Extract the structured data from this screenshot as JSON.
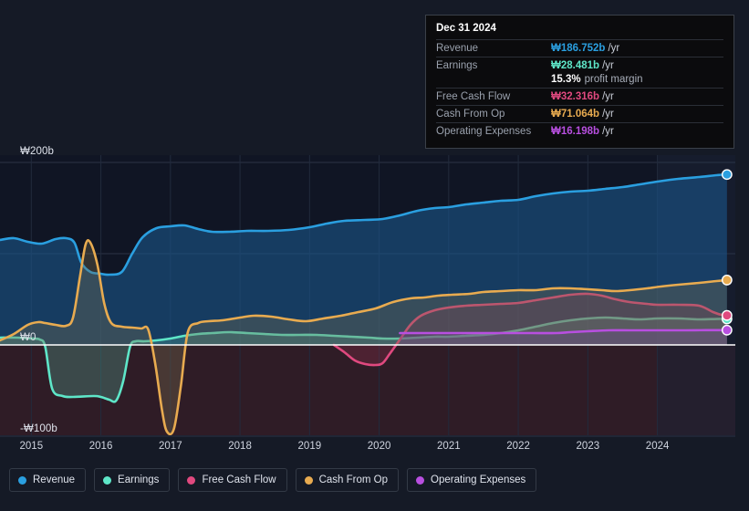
{
  "chart_data": {
    "type": "area",
    "title": "",
    "xlabel": "",
    "ylabel": "",
    "currency": "₩",
    "unit": "b",
    "ylim": [
      -140,
      230
    ],
    "yticks": [
      200,
      100,
      0,
      -100
    ],
    "ytick_labels": [
      "₩200b",
      "",
      "₩0",
      "-₩100b"
    ],
    "grid": true,
    "legend_position": "bottom",
    "xlim": [
      2014.55,
      2025.12
    ],
    "xticks": [
      2015,
      2016,
      2017,
      2018,
      2019,
      2020,
      2021,
      2022,
      2023,
      2024
    ],
    "xtick_labels": [
      "2015",
      "2016",
      "2017",
      "2018",
      "2019",
      "2020",
      "2021",
      "2022",
      "2023",
      "2024"
    ],
    "forecast_band_start": 2024.0,
    "series": [
      {
        "name": "Revenue",
        "color": "#2a9fe0",
        "fill": "rgba(26,84,136,0.62)",
        "end_value": 186.752,
        "points": [
          [
            2014.55,
            115
          ],
          [
            2014.75,
            117
          ],
          [
            2014.95,
            113
          ],
          [
            2015.15,
            111
          ],
          [
            2015.35,
            116
          ],
          [
            2015.5,
            117
          ],
          [
            2015.62,
            112
          ],
          [
            2015.72,
            90
          ],
          [
            2015.85,
            80
          ],
          [
            2016.0,
            78
          ],
          [
            2016.12,
            77
          ],
          [
            2016.3,
            80
          ],
          [
            2016.45,
            100
          ],
          [
            2016.6,
            118
          ],
          [
            2016.8,
            128
          ],
          [
            2017.0,
            130
          ],
          [
            2017.2,
            131
          ],
          [
            2017.4,
            127
          ],
          [
            2017.6,
            124
          ],
          [
            2017.85,
            124
          ],
          [
            2018.1,
            125
          ],
          [
            2018.4,
            125
          ],
          [
            2018.7,
            126
          ],
          [
            2019.0,
            129
          ],
          [
            2019.25,
            133
          ],
          [
            2019.5,
            136
          ],
          [
            2019.8,
            137
          ],
          [
            2020.05,
            138
          ],
          [
            2020.3,
            142
          ],
          [
            2020.55,
            147
          ],
          [
            2020.8,
            150
          ],
          [
            2021.0,
            151
          ],
          [
            2021.25,
            154
          ],
          [
            2021.5,
            156
          ],
          [
            2021.75,
            158
          ],
          [
            2022.0,
            159
          ],
          [
            2022.25,
            163
          ],
          [
            2022.5,
            166
          ],
          [
            2022.75,
            168
          ],
          [
            2023.0,
            169
          ],
          [
            2023.25,
            171
          ],
          [
            2023.5,
            173
          ],
          [
            2023.75,
            176
          ],
          [
            2024.0,
            179
          ],
          [
            2024.3,
            182
          ],
          [
            2024.6,
            184
          ],
          [
            2024.85,
            186
          ],
          [
            2025.0,
            186.752
          ]
        ]
      },
      {
        "name": "Earnings",
        "color": "#5ee6c8",
        "fill": "rgba(90,180,160,0.30)",
        "end_value": 28.481,
        "points": [
          [
            2014.55,
            8
          ],
          [
            2014.8,
            8
          ],
          [
            2015.0,
            7
          ],
          [
            2015.12,
            6
          ],
          [
            2015.2,
            -2
          ],
          [
            2015.3,
            -48
          ],
          [
            2015.45,
            -56
          ],
          [
            2015.6,
            -57
          ],
          [
            2015.9,
            -56
          ],
          [
            2016.0,
            -57
          ],
          [
            2016.12,
            -60
          ],
          [
            2016.22,
            -61
          ],
          [
            2016.32,
            -40
          ],
          [
            2016.42,
            -2
          ],
          [
            2016.5,
            4
          ],
          [
            2016.62,
            4
          ],
          [
            2016.8,
            5
          ],
          [
            2017.0,
            7
          ],
          [
            2017.2,
            10
          ],
          [
            2017.4,
            12
          ],
          [
            2017.6,
            13
          ],
          [
            2017.85,
            14
          ],
          [
            2018.1,
            13
          ],
          [
            2018.35,
            12
          ],
          [
            2018.6,
            11
          ],
          [
            2018.85,
            11
          ],
          [
            2019.1,
            11
          ],
          [
            2019.35,
            10
          ],
          [
            2019.6,
            9
          ],
          [
            2019.85,
            8
          ],
          [
            2020.05,
            7
          ],
          [
            2020.3,
            7
          ],
          [
            2020.55,
            8
          ],
          [
            2020.8,
            9
          ],
          [
            2021.0,
            9
          ],
          [
            2021.25,
            10
          ],
          [
            2021.5,
            11
          ],
          [
            2021.75,
            13
          ],
          [
            2022.0,
            16
          ],
          [
            2022.25,
            20
          ],
          [
            2022.5,
            24
          ],
          [
            2022.75,
            27
          ],
          [
            2023.0,
            29
          ],
          [
            2023.25,
            30
          ],
          [
            2023.5,
            29
          ],
          [
            2023.75,
            28
          ],
          [
            2024.0,
            29
          ],
          [
            2024.3,
            29
          ],
          [
            2024.6,
            28
          ],
          [
            2024.85,
            28.481
          ],
          [
            2025.0,
            28.481
          ]
        ]
      },
      {
        "name": "Free Cash Flow",
        "color": "#e0497f",
        "fill": "rgba(150,50,80,0.30)",
        "end_value": 32.316,
        "start_x": 2019.35,
        "points": [
          [
            2019.35,
            0
          ],
          [
            2019.5,
            -8
          ],
          [
            2019.65,
            -17
          ],
          [
            2019.8,
            -21
          ],
          [
            2019.95,
            -22
          ],
          [
            2020.05,
            -20
          ],
          [
            2020.15,
            -10
          ],
          [
            2020.3,
            6
          ],
          [
            2020.45,
            22
          ],
          [
            2020.6,
            32
          ],
          [
            2020.8,
            38
          ],
          [
            2021.0,
            41
          ],
          [
            2021.25,
            43
          ],
          [
            2021.5,
            44
          ],
          [
            2021.75,
            45
          ],
          [
            2022.0,
            46
          ],
          [
            2022.25,
            49
          ],
          [
            2022.5,
            52
          ],
          [
            2022.75,
            55
          ],
          [
            2023.0,
            56
          ],
          [
            2023.2,
            54
          ],
          [
            2023.4,
            50
          ],
          [
            2023.6,
            47
          ],
          [
            2023.85,
            45
          ],
          [
            2024.0,
            44
          ],
          [
            2024.3,
            44
          ],
          [
            2024.6,
            43
          ],
          [
            2024.8,
            36
          ],
          [
            2024.95,
            32.316
          ],
          [
            2025.0,
            32.316
          ]
        ]
      },
      {
        "name": "Cash From Op",
        "color": "#e8ab50",
        "fill": "rgba(120,110,80,0.34)",
        "end_value": 71.064,
        "points": [
          [
            2014.55,
            5
          ],
          [
            2014.75,
            12
          ],
          [
            2014.95,
            22
          ],
          [
            2015.1,
            25
          ],
          [
            2015.2,
            24
          ],
          [
            2015.35,
            22
          ],
          [
            2015.5,
            21
          ],
          [
            2015.6,
            30
          ],
          [
            2015.7,
            75
          ],
          [
            2015.78,
            110
          ],
          [
            2015.85,
            112
          ],
          [
            2015.95,
            88
          ],
          [
            2016.05,
            45
          ],
          [
            2016.15,
            24
          ],
          [
            2016.3,
            20
          ],
          [
            2016.45,
            19
          ],
          [
            2016.58,
            18
          ],
          [
            2016.68,
            17
          ],
          [
            2016.78,
            -20
          ],
          [
            2016.88,
            -72
          ],
          [
            2016.95,
            -95
          ],
          [
            2017.05,
            -92
          ],
          [
            2017.15,
            -45
          ],
          [
            2017.25,
            14
          ],
          [
            2017.4,
            24
          ],
          [
            2017.55,
            26
          ],
          [
            2017.75,
            27
          ],
          [
            2018.0,
            30
          ],
          [
            2018.2,
            32
          ],
          [
            2018.45,
            31
          ],
          [
            2018.7,
            28
          ],
          [
            2018.95,
            26
          ],
          [
            2019.2,
            29
          ],
          [
            2019.45,
            32
          ],
          [
            2019.7,
            36
          ],
          [
            2019.95,
            40
          ],
          [
            2020.2,
            47
          ],
          [
            2020.45,
            51
          ],
          [
            2020.65,
            52
          ],
          [
            2020.85,
            54
          ],
          [
            2021.05,
            55
          ],
          [
            2021.3,
            56
          ],
          [
            2021.5,
            58
          ],
          [
            2021.75,
            59
          ],
          [
            2022.0,
            60
          ],
          [
            2022.25,
            60
          ],
          [
            2022.5,
            62
          ],
          [
            2022.75,
            62
          ],
          [
            2023.0,
            61
          ],
          [
            2023.2,
            60
          ],
          [
            2023.4,
            59
          ],
          [
            2023.6,
            60
          ],
          [
            2023.85,
            62
          ],
          [
            2024.05,
            64
          ],
          [
            2024.3,
            66
          ],
          [
            2024.6,
            68
          ],
          [
            2024.85,
            70
          ],
          [
            2025.0,
            71.064
          ]
        ]
      },
      {
        "name": "Operating Expenses",
        "color": "#b84fe0",
        "fill": "rgba(110,70,150,0.28)",
        "end_value": 16.198,
        "start_x": 2020.3,
        "points": [
          [
            2020.3,
            13
          ],
          [
            2020.6,
            13
          ],
          [
            2021.0,
            13
          ],
          [
            2021.4,
            13
          ],
          [
            2021.8,
            13
          ],
          [
            2022.2,
            13
          ],
          [
            2022.55,
            13
          ],
          [
            2022.75,
            14
          ],
          [
            2023.0,
            15
          ],
          [
            2023.3,
            16
          ],
          [
            2023.6,
            16
          ],
          [
            2024.0,
            16
          ],
          [
            2024.4,
            16
          ],
          [
            2024.7,
            16.198
          ],
          [
            2025.0,
            16.198
          ]
        ]
      }
    ]
  },
  "tooltip": {
    "title": "Dec 31 2024",
    "rows": [
      {
        "label": "Revenue",
        "value": "₩186.752b",
        "unit": "/yr",
        "color": "#2a9fe0"
      },
      {
        "label": "Earnings",
        "value": "₩28.481b",
        "unit": "/yr",
        "color": "#5ee6c8"
      },
      {
        "label": "Free Cash Flow",
        "value": "₩32.316b",
        "unit": "/yr",
        "color": "#e0497f"
      },
      {
        "label": "Cash From Op",
        "value": "₩71.064b",
        "unit": "/yr",
        "color": "#e8ab50"
      },
      {
        "label": "Operating Expenses",
        "value": "₩16.198b",
        "unit": "/yr",
        "color": "#b84fe0"
      }
    ],
    "margin_value": "15.3%",
    "margin_text": "profit margin"
  },
  "legend": {
    "items": [
      {
        "label": "Revenue",
        "color": "#2a9fe0"
      },
      {
        "label": "Earnings",
        "color": "#5ee6c8"
      },
      {
        "label": "Free Cash Flow",
        "color": "#e0497f"
      },
      {
        "label": "Cash From Op",
        "color": "#e8ab50"
      },
      {
        "label": "Operating Expenses",
        "color": "#b84fe0"
      }
    ]
  },
  "colors": {
    "background": "#151a26",
    "plot_background": "#101524",
    "zero_line": "#ffffff",
    "grid": "#2b3346",
    "negative_fill": "#3d2028"
  }
}
